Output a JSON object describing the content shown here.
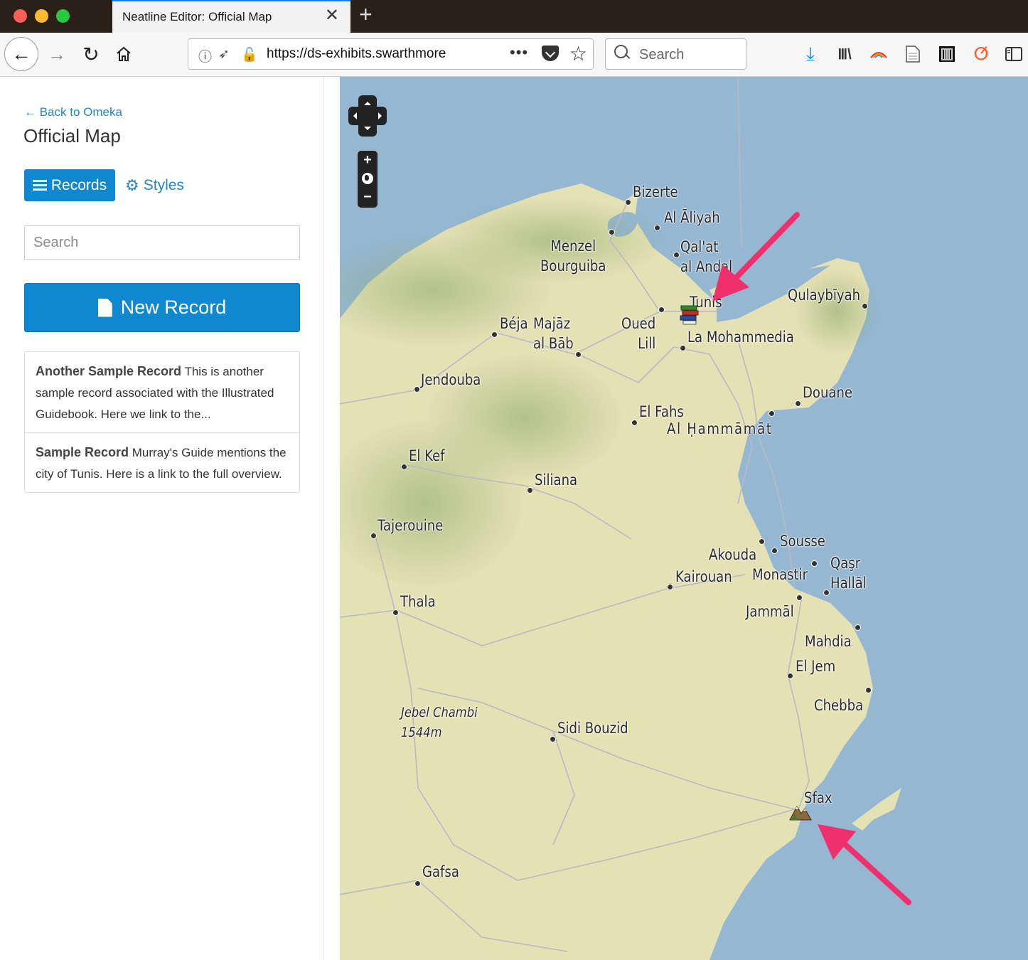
{
  "browser": {
    "tab_title": "Neatline Editor: Official Map",
    "url": "https://ds-exhibits.swarthmore",
    "search_placeholder": "Search"
  },
  "panel": {
    "back_link": "← Back to Omeka",
    "title": "Official Map",
    "tabs": [
      {
        "label": "Records",
        "active": true
      },
      {
        "label": "Styles",
        "active": false
      }
    ],
    "search_placeholder": "Search",
    "new_record_label": "New Record",
    "records": [
      {
        "title": "Another Sample Record",
        "body": " This is another sample record associated with the Illustrated Guidebook. Here we link to the..."
      },
      {
        "title": "Sample Record",
        "body": " Murray's Guide mentions the city of Tunis. Here is a link to the full overview."
      }
    ]
  },
  "map": {
    "labels": [
      {
        "text": "Bizerte"
      },
      {
        "text": "Al Āliyah"
      },
      {
        "text": "Menzel\nBourguiba"
      },
      {
        "text": "Qal'at\nal Andal"
      },
      {
        "text": "Tunis"
      },
      {
        "text": "Qulaybīyah"
      },
      {
        "text": "Béja"
      },
      {
        "text": "Majāz\nal Bāb"
      },
      {
        "text": "Oued\nLill"
      },
      {
        "text": "La Mohammedia"
      },
      {
        "text": "Jendouba"
      },
      {
        "text": "Douane"
      },
      {
        "text": "El Fahs"
      },
      {
        "text": "Al Ḥammāmāt"
      },
      {
        "text": "El Kef"
      },
      {
        "text": "Siliana"
      },
      {
        "text": "Tajerouine"
      },
      {
        "text": "Sousse"
      },
      {
        "text": "Akouda"
      },
      {
        "text": "Qaşr\nHallāl"
      },
      {
        "text": "Kairouan"
      },
      {
        "text": "Monastir"
      },
      {
        "text": "Thala"
      },
      {
        "text": "Jammāl"
      },
      {
        "text": "Mahdia"
      },
      {
        "text": "El Jem"
      },
      {
        "text": "Chebba"
      },
      {
        "text": "Jebel Chambi\n1544m"
      },
      {
        "text": "Sidi Bouzid"
      },
      {
        "text": "Sfax"
      },
      {
        "text": "Gafsa"
      }
    ],
    "colors": {
      "water": "#95b7d2",
      "land": "#e4e1b4",
      "arrow": "#f0306c",
      "accent": "#0f88d0"
    }
  }
}
